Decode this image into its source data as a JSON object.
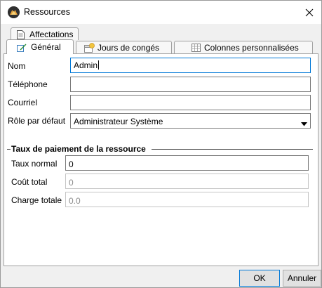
{
  "window": {
    "title": "Ressources",
    "close_icon": "close-icon"
  },
  "tabs": {
    "row1": [
      {
        "label": "Affectations",
        "icon": "document-icon"
      }
    ],
    "row2": [
      {
        "label": "Général",
        "icon": "edit-icon",
        "active": true
      },
      {
        "label": "Jours de congés",
        "icon": "calendar-icon",
        "active": false
      },
      {
        "label": "Colonnes personnalisées",
        "icon": "table-icon",
        "active": false
      }
    ]
  },
  "general": {
    "fields": {
      "nom": {
        "label": "Nom",
        "value": "Admin"
      },
      "telephone": {
        "label": "Téléphone",
        "value": ""
      },
      "courriel": {
        "label": "Courriel",
        "value": ""
      },
      "role": {
        "label": "Rôle par défaut",
        "value": "Administrateur Système"
      }
    },
    "pay_group": {
      "title": "Taux de paiement de la ressource",
      "taux_normal": {
        "label": "Taux normal",
        "value": "0"
      },
      "cout_total": {
        "label": "Coût total",
        "value": "0"
      },
      "charge_totale": {
        "label": "Charge totale",
        "value": "0.0"
      }
    }
  },
  "buttons": {
    "ok": "OK",
    "cancel": "Annuler"
  },
  "colors": {
    "focus_border": "#0078d7",
    "panel_background": "#ffffff",
    "window_background": "#f0f0f0"
  }
}
